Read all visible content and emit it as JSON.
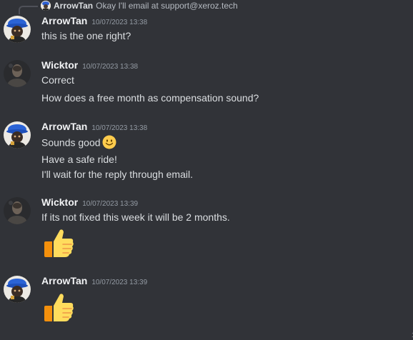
{
  "reply_preview": {
    "username": "ArrowTan",
    "text": "Okay I'll email at support@xeroz.tech",
    "avatar_icon": "user-avatar-icon"
  },
  "messages": [
    {
      "username": "ArrowTan",
      "timestamp": "10/07/2023 13:38",
      "avatar": "arrowtan-avatar",
      "lines": [
        "this is the one right?"
      ]
    },
    {
      "username": "Wicktor",
      "timestamp": "10/07/2023 13:38",
      "avatar": "wicktor-avatar",
      "lines": [
        "Correct",
        "How does a free month as compensation sound?"
      ]
    },
    {
      "username": "ArrowTan",
      "timestamp": "10/07/2023 13:38",
      "avatar": "arrowtan-avatar",
      "lines": [
        "Sounds good",
        "Have a safe ride!",
        "I'll wait for the reply through email."
      ],
      "inline_emoji": "slightly-smiling-face-icon"
    },
    {
      "username": "Wicktor",
      "timestamp": "10/07/2023 13:39",
      "avatar": "wicktor-avatar",
      "lines": [
        "If its not fixed this week it will be 2 months."
      ],
      "jumbo_emoji": "thumbs-up-icon"
    },
    {
      "username": "ArrowTan",
      "timestamp": "10/07/2023 13:39",
      "avatar": "arrowtan-avatar",
      "lines": [],
      "jumbo_emoji": "thumbs-up-icon"
    }
  ],
  "corner_text": "1",
  "colors": {
    "background": "#313338",
    "username": "#f2f3f5",
    "text": "#dbdee1",
    "timestamp": "#949ba4"
  }
}
